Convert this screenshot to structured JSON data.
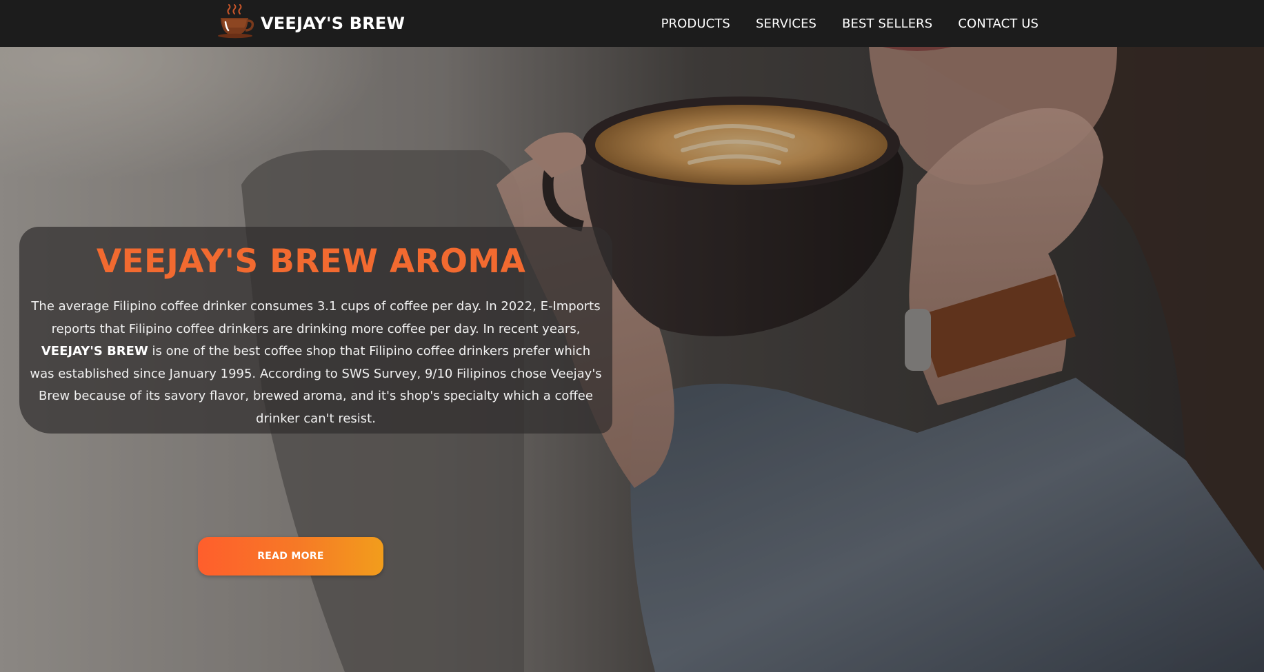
{
  "navbar": {
    "brand_name": "VEEJAY'S BREW",
    "logo_icon": "coffee-cup-logo",
    "links": [
      {
        "label": "PRODUCTS"
      },
      {
        "label": "SERVICES"
      },
      {
        "label": "BEST SELLERS"
      },
      {
        "label": "CONTACT US"
      }
    ]
  },
  "hero": {
    "background_image": "woman-holding-latte-cup-photo",
    "title": "VEEJAY'S BREW AROMA",
    "paragraph": {
      "part1": "The average Filipino coffee drinker consumes 3.1 cups of coffee per day. In 2022, E-Imports reports that Filipino coffee drinkers are drinking more coffee per day. In recent years, ",
      "strong": "VEEJAY'S BREW",
      "part2": " is one of the best coffee shop that Filipino coffee drinkers prefer which was established since January 1995. According to SWS Survey, 9/10 Filipinos chose Veejay's Brew because of its savory flavor, brewed aroma, and it's shop's specialty which a coffee drinker can't resist."
    },
    "button_label": "READ MORE"
  },
  "colors": {
    "navbar_bg": "#1c1c1c",
    "accent_orange": "#f26a30",
    "button_gradient_start": "#ff5e2c",
    "button_gradient_end": "#f29d1c",
    "card_bg": "rgba(48,46,46,0.72)"
  }
}
